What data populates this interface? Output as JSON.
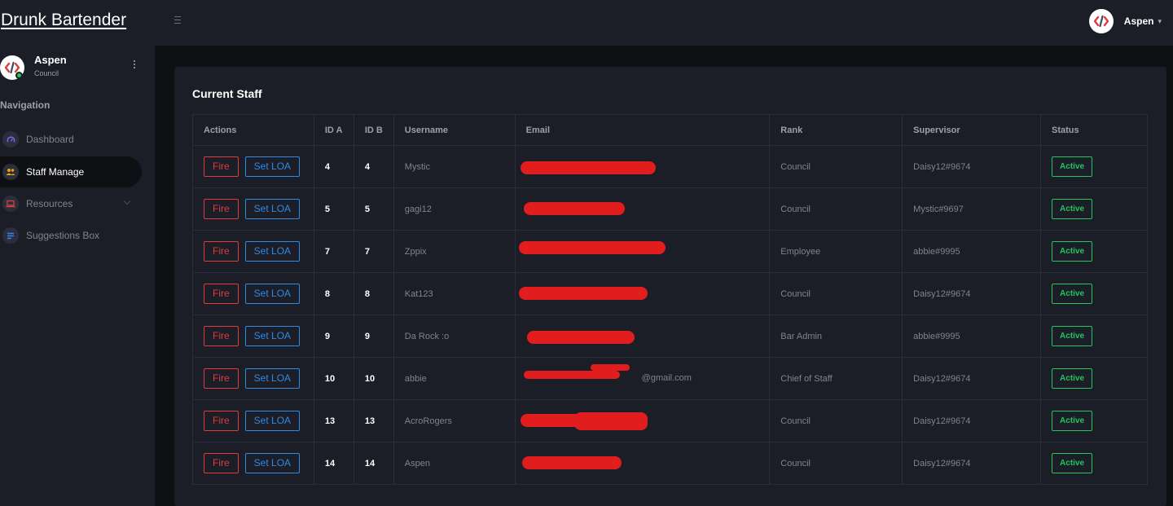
{
  "app": {
    "title": "Drunk Bartender",
    "colors": {
      "bg": "#0f1014",
      "panel": "#1b1e27",
      "danger": "#e03c3c",
      "info": "#2f8ae6",
      "success": "#22c55e"
    }
  },
  "header": {
    "menu_icon": "hamburger-icon",
    "user_name": "Aspen",
    "caret": "▾"
  },
  "sidebar": {
    "user_name": "Aspen",
    "user_role": "Council",
    "nav_heading": "Navigation",
    "items": [
      {
        "label": "Dashboard",
        "icon": "gauge-icon",
        "active": false
      },
      {
        "label": "Staff Manage",
        "icon": "users-icon",
        "active": true
      },
      {
        "label": "Resources",
        "icon": "laptop-icon",
        "active": false,
        "has_submenu": true
      },
      {
        "label": "Suggestions Box",
        "icon": "list-icon",
        "active": false
      }
    ]
  },
  "main": {
    "card_title": "Current Staff",
    "columns": [
      "Actions",
      "ID A",
      "ID B",
      "Username",
      "Email",
      "Rank",
      "Supervisor",
      "Status"
    ],
    "action_labels": {
      "fire": "Fire",
      "loa": "Set LOA"
    },
    "rows": [
      {
        "id_a": "4",
        "id_b": "4",
        "username": "Mystic",
        "email": "",
        "rank": "Council",
        "supervisor": "Daisy12#9674",
        "status": "Active"
      },
      {
        "id_a": "5",
        "id_b": "5",
        "username": "gagi12",
        "email": "",
        "rank": "Council",
        "supervisor": "Mystic#9697",
        "status": "Active"
      },
      {
        "id_a": "7",
        "id_b": "7",
        "username": "Zppix",
        "email": "",
        "rank": "Employee",
        "supervisor": "abbie#9995",
        "status": "Active"
      },
      {
        "id_a": "8",
        "id_b": "8",
        "username": "Kat123",
        "email": "",
        "rank": "Council",
        "supervisor": "Daisy12#9674",
        "status": "Active"
      },
      {
        "id_a": "9",
        "id_b": "9",
        "username": "Da Rock :o",
        "email": "",
        "rank": "Bar Admin",
        "supervisor": "abbie#9995",
        "status": "Active"
      },
      {
        "id_a": "10",
        "id_b": "10",
        "username": "abbie",
        "email": "@gmail.com",
        "rank": "Chief of Staff",
        "supervisor": "Daisy12#9674",
        "status": "Active"
      },
      {
        "id_a": "13",
        "id_b": "13",
        "username": "AcroRogers",
        "email": "",
        "rank": "Council",
        "supervisor": "Daisy12#9674",
        "status": "Active"
      },
      {
        "id_a": "14",
        "id_b": "14",
        "username": "Aspen",
        "email": "",
        "rank": "Council",
        "supervisor": "Daisy12#9674",
        "status": "Active"
      }
    ]
  }
}
